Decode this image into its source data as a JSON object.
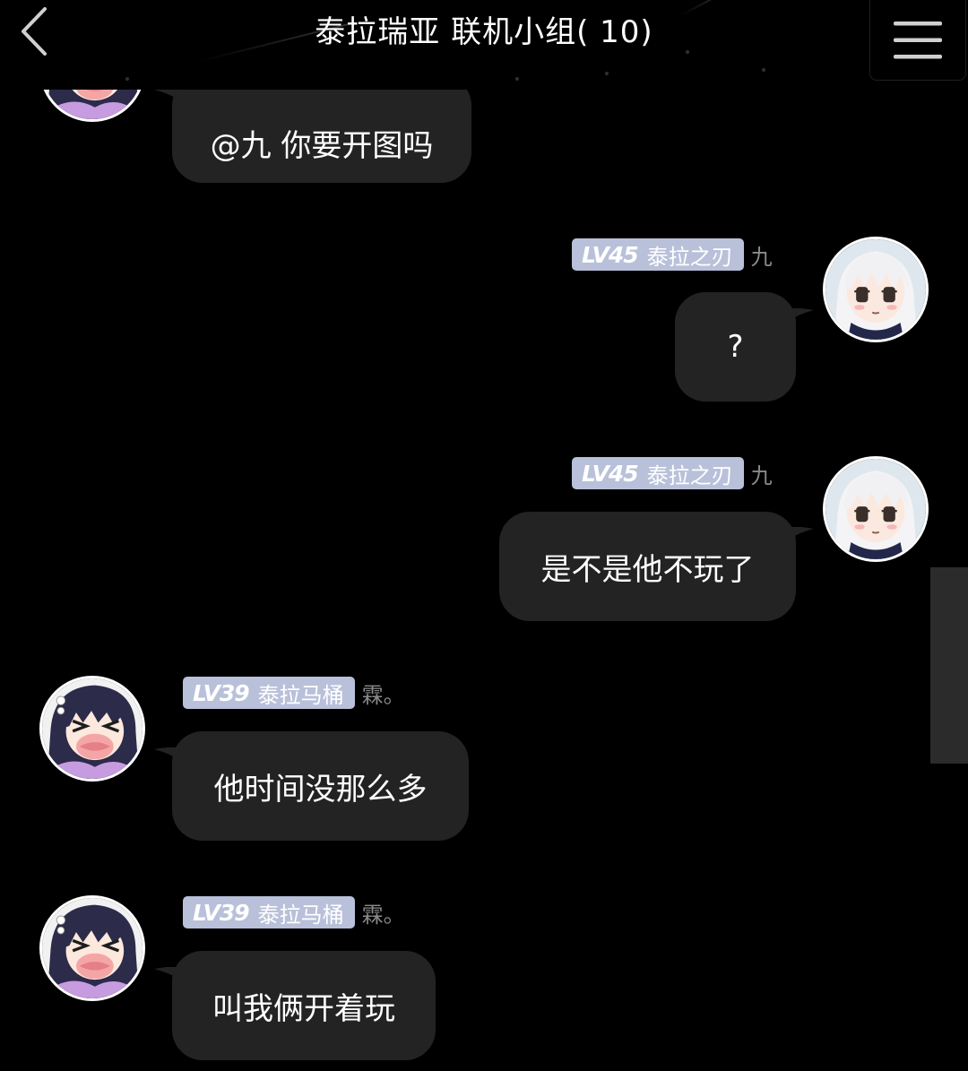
{
  "header": {
    "title": "泰拉瑞亚 联机小组( 10)",
    "back_icon": "chevron-left-icon",
    "menu_icon": "hamburger-menu-icon"
  },
  "messages": [
    {
      "side": "left",
      "avatar": "purple-hair-anime-avatar",
      "text": "@九 你要开图吗"
    },
    {
      "side": "right",
      "avatar": "white-hair-anime-avatar",
      "level": "LV45",
      "badge_title": "泰拉之刃",
      "nickname": "九",
      "text": "?"
    },
    {
      "side": "right",
      "avatar": "white-hair-anime-avatar",
      "level": "LV45",
      "badge_title": "泰拉之刃",
      "nickname": "九",
      "text": "是不是他不玩了"
    },
    {
      "side": "left",
      "avatar": "purple-hair-anime-avatar",
      "level": "LV39",
      "badge_title": "泰拉马桶",
      "nickname": "霖。",
      "text": "他时间没那么多"
    },
    {
      "side": "left",
      "avatar": "purple-hair-anime-avatar",
      "level": "LV39",
      "badge_title": "泰拉马桶",
      "nickname": "霖。",
      "text": "叫我俩开着玩"
    }
  ],
  "colors": {
    "background": "#000000",
    "bubble": "#232323",
    "badge": "#b9c0d9",
    "nickname": "#8a8a8a"
  }
}
